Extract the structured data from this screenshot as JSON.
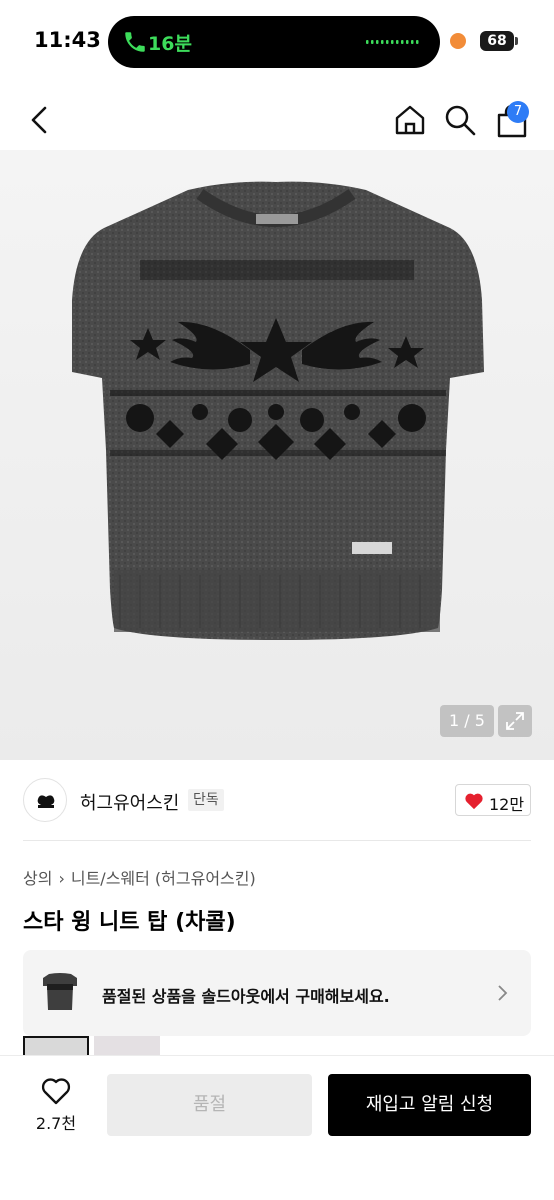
{
  "status_bar": {
    "time": "11:43",
    "call_duration": "16분",
    "battery": "68",
    "call_color": "#3ddc5b",
    "record_dot_color": "#f28c38"
  },
  "nav": {
    "back_icon": "chevron-left-icon",
    "home_icon": "home-icon",
    "search_icon": "search-icon",
    "cart_icon": "shopping-bag-icon",
    "cart_count": "7",
    "badge_color": "#2e7cf6"
  },
  "gallery": {
    "counter": "1 / 5",
    "expand_icon": "expand-icon"
  },
  "brand": {
    "name": "허그유어스킨",
    "badge": "단독",
    "likes": "12만",
    "like_icon_color": "#e5202e"
  },
  "breadcrumb": {
    "category": "상의",
    "subcategory": "니트/스웨터 (허그유어스킨)"
  },
  "product": {
    "title": "스타 윙 니트 탑 (차콜)"
  },
  "soldout_banner": {
    "text": "품절된 상품을 솔드아웃에서 구매해보세요."
  },
  "bottom_bar": {
    "wish_count": "2.7천",
    "soldout_label": "품절",
    "restock_label": "재입고 알림 신청"
  }
}
